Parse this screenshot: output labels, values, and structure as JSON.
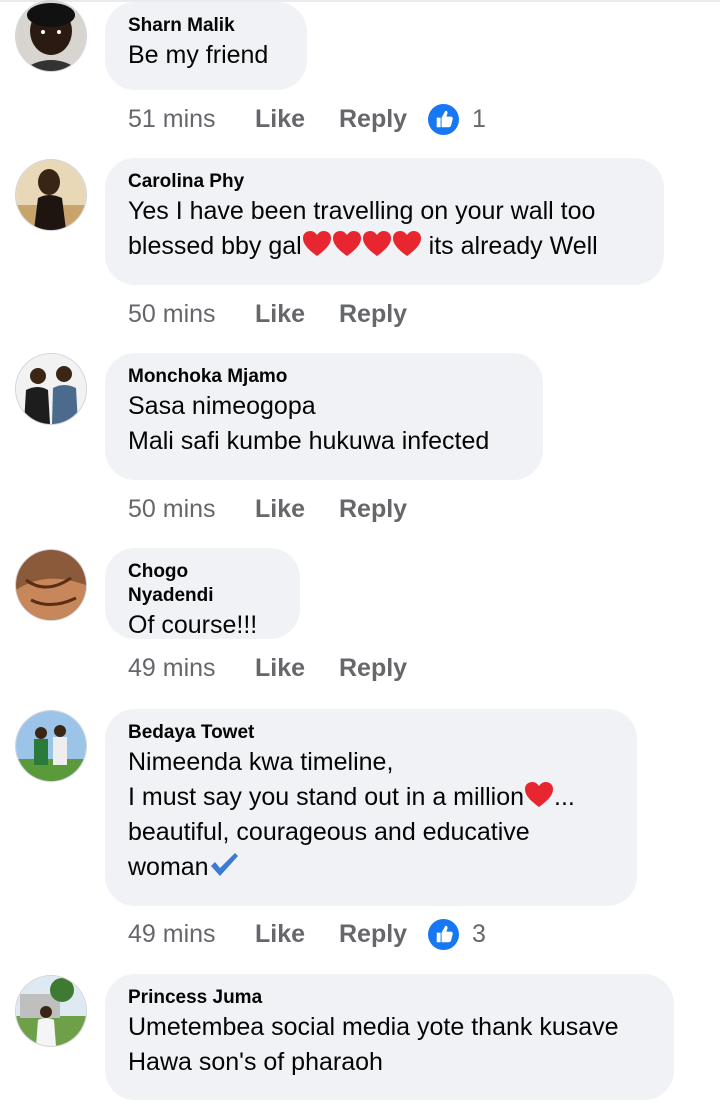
{
  "comments": [
    {
      "author": "Sharn Malik",
      "lines": [
        "Be my friend"
      ],
      "time": "51 mins",
      "like": "Like",
      "reply": "Reply",
      "reactions": "1"
    },
    {
      "author": "Carolina Phy",
      "line1": "Yes I have been travelling on your wall too",
      "line2_before": "blessed bby gal",
      "line2_after": " its already Well",
      "time": "50 mins",
      "like": "Like",
      "reply": "Reply"
    },
    {
      "author": "Monchoka Mjamo",
      "lines": [
        "Sasa nimeogopa",
        "Mali safi kumbe hukuwa infected"
      ],
      "time": "50 mins",
      "like": "Like",
      "reply": "Reply"
    },
    {
      "author": "Chogo Nyadendi",
      "lines": [
        "Of course!!!"
      ],
      "time": "49 mins",
      "like": "Like",
      "reply": "Reply"
    },
    {
      "author": "Bedaya Towet",
      "line1": "Nimeenda kwa timeline,",
      "line2_before": "I must say you stand out in a million",
      "line2_after": "...",
      "line3": "beautiful, courageous and educative",
      "line4": "woman",
      "time": "49 mins",
      "like": "Like",
      "reply": "Reply",
      "reactions": "3"
    },
    {
      "author": "Princess Juma",
      "lines": [
        "Umetembea social media yote thank kusave",
        "Hawa son's of pharaoh"
      ]
    }
  ],
  "icons": {
    "like_reaction": "thumbs-up-icon",
    "heart": "red-heart-emoji",
    "check": "blue-check-mark-emoji"
  },
  "colors": {
    "like_blue": "#1877f2",
    "heart_red": "#e8262f",
    "meta_gray": "#65676b",
    "bubble": "#f0f2f5"
  }
}
